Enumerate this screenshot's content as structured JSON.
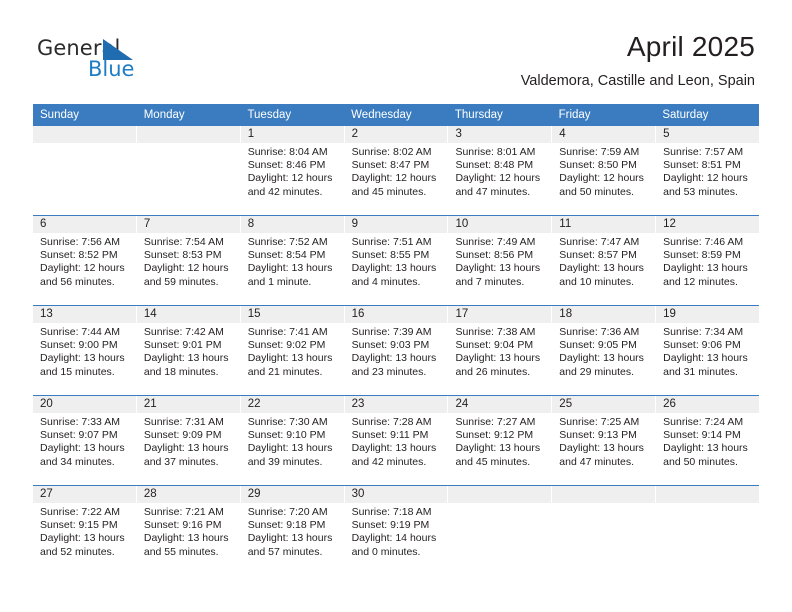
{
  "brand": {
    "line1": "General",
    "line2": "Blue",
    "mark": "triangle-logo-icon",
    "accent": "#1f7dc4"
  },
  "header": {
    "title": "April 2025",
    "subtitle": "Valdemora, Castille and Leon, Spain"
  },
  "colors": {
    "header_blue": "#3a7cbf",
    "daynum_band": "#efefef",
    "text": "#231f20"
  },
  "weekday_headers": [
    "Sunday",
    "Monday",
    "Tuesday",
    "Wednesday",
    "Thursday",
    "Friday",
    "Saturday"
  ],
  "labels": {
    "sunrise_prefix": "Sunrise:",
    "sunset_prefix": "Sunset:",
    "daylight_prefix": "Daylight:"
  },
  "weeks": [
    [
      {
        "day": "",
        "sunrise": "",
        "sunset": "",
        "daylight": "",
        "empty": true
      },
      {
        "day": "",
        "sunrise": "",
        "sunset": "",
        "daylight": "",
        "empty": true
      },
      {
        "day": "1",
        "sunrise": "Sunrise: 8:04 AM",
        "sunset": "Sunset: 8:46 PM",
        "daylight_l1": "Daylight: 12 hours",
        "daylight_l2": "and 42 minutes."
      },
      {
        "day": "2",
        "sunrise": "Sunrise: 8:02 AM",
        "sunset": "Sunset: 8:47 PM",
        "daylight_l1": "Daylight: 12 hours",
        "daylight_l2": "and 45 minutes."
      },
      {
        "day": "3",
        "sunrise": "Sunrise: 8:01 AM",
        "sunset": "Sunset: 8:48 PM",
        "daylight_l1": "Daylight: 12 hours",
        "daylight_l2": "and 47 minutes."
      },
      {
        "day": "4",
        "sunrise": "Sunrise: 7:59 AM",
        "sunset": "Sunset: 8:50 PM",
        "daylight_l1": "Daylight: 12 hours",
        "daylight_l2": "and 50 minutes."
      },
      {
        "day": "5",
        "sunrise": "Sunrise: 7:57 AM",
        "sunset": "Sunset: 8:51 PM",
        "daylight_l1": "Daylight: 12 hours",
        "daylight_l2": "and 53 minutes."
      }
    ],
    [
      {
        "day": "6",
        "sunrise": "Sunrise: 7:56 AM",
        "sunset": "Sunset: 8:52 PM",
        "daylight_l1": "Daylight: 12 hours",
        "daylight_l2": "and 56 minutes."
      },
      {
        "day": "7",
        "sunrise": "Sunrise: 7:54 AM",
        "sunset": "Sunset: 8:53 PM",
        "daylight_l1": "Daylight: 12 hours",
        "daylight_l2": "and 59 minutes."
      },
      {
        "day": "8",
        "sunrise": "Sunrise: 7:52 AM",
        "sunset": "Sunset: 8:54 PM",
        "daylight_l1": "Daylight: 13 hours",
        "daylight_l2": "and 1 minute."
      },
      {
        "day": "9",
        "sunrise": "Sunrise: 7:51 AM",
        "sunset": "Sunset: 8:55 PM",
        "daylight_l1": "Daylight: 13 hours",
        "daylight_l2": "and 4 minutes."
      },
      {
        "day": "10",
        "sunrise": "Sunrise: 7:49 AM",
        "sunset": "Sunset: 8:56 PM",
        "daylight_l1": "Daylight: 13 hours",
        "daylight_l2": "and 7 minutes."
      },
      {
        "day": "11",
        "sunrise": "Sunrise: 7:47 AM",
        "sunset": "Sunset: 8:57 PM",
        "daylight_l1": "Daylight: 13 hours",
        "daylight_l2": "and 10 minutes."
      },
      {
        "day": "12",
        "sunrise": "Sunrise: 7:46 AM",
        "sunset": "Sunset: 8:59 PM",
        "daylight_l1": "Daylight: 13 hours",
        "daylight_l2": "and 12 minutes."
      }
    ],
    [
      {
        "day": "13",
        "sunrise": "Sunrise: 7:44 AM",
        "sunset": "Sunset: 9:00 PM",
        "daylight_l1": "Daylight: 13 hours",
        "daylight_l2": "and 15 minutes."
      },
      {
        "day": "14",
        "sunrise": "Sunrise: 7:42 AM",
        "sunset": "Sunset: 9:01 PM",
        "daylight_l1": "Daylight: 13 hours",
        "daylight_l2": "and 18 minutes."
      },
      {
        "day": "15",
        "sunrise": "Sunrise: 7:41 AM",
        "sunset": "Sunset: 9:02 PM",
        "daylight_l1": "Daylight: 13 hours",
        "daylight_l2": "and 21 minutes."
      },
      {
        "day": "16",
        "sunrise": "Sunrise: 7:39 AM",
        "sunset": "Sunset: 9:03 PM",
        "daylight_l1": "Daylight: 13 hours",
        "daylight_l2": "and 23 minutes."
      },
      {
        "day": "17",
        "sunrise": "Sunrise: 7:38 AM",
        "sunset": "Sunset: 9:04 PM",
        "daylight_l1": "Daylight: 13 hours",
        "daylight_l2": "and 26 minutes."
      },
      {
        "day": "18",
        "sunrise": "Sunrise: 7:36 AM",
        "sunset": "Sunset: 9:05 PM",
        "daylight_l1": "Daylight: 13 hours",
        "daylight_l2": "and 29 minutes."
      },
      {
        "day": "19",
        "sunrise": "Sunrise: 7:34 AM",
        "sunset": "Sunset: 9:06 PM",
        "daylight_l1": "Daylight: 13 hours",
        "daylight_l2": "and 31 minutes."
      }
    ],
    [
      {
        "day": "20",
        "sunrise": "Sunrise: 7:33 AM",
        "sunset": "Sunset: 9:07 PM",
        "daylight_l1": "Daylight: 13 hours",
        "daylight_l2": "and 34 minutes."
      },
      {
        "day": "21",
        "sunrise": "Sunrise: 7:31 AM",
        "sunset": "Sunset: 9:09 PM",
        "daylight_l1": "Daylight: 13 hours",
        "daylight_l2": "and 37 minutes."
      },
      {
        "day": "22",
        "sunrise": "Sunrise: 7:30 AM",
        "sunset": "Sunset: 9:10 PM",
        "daylight_l1": "Daylight: 13 hours",
        "daylight_l2": "and 39 minutes."
      },
      {
        "day": "23",
        "sunrise": "Sunrise: 7:28 AM",
        "sunset": "Sunset: 9:11 PM",
        "daylight_l1": "Daylight: 13 hours",
        "daylight_l2": "and 42 minutes."
      },
      {
        "day": "24",
        "sunrise": "Sunrise: 7:27 AM",
        "sunset": "Sunset: 9:12 PM",
        "daylight_l1": "Daylight: 13 hours",
        "daylight_l2": "and 45 minutes."
      },
      {
        "day": "25",
        "sunrise": "Sunrise: 7:25 AM",
        "sunset": "Sunset: 9:13 PM",
        "daylight_l1": "Daylight: 13 hours",
        "daylight_l2": "and 47 minutes."
      },
      {
        "day": "26",
        "sunrise": "Sunrise: 7:24 AM",
        "sunset": "Sunset: 9:14 PM",
        "daylight_l1": "Daylight: 13 hours",
        "daylight_l2": "and 50 minutes."
      }
    ],
    [
      {
        "day": "27",
        "sunrise": "Sunrise: 7:22 AM",
        "sunset": "Sunset: 9:15 PM",
        "daylight_l1": "Daylight: 13 hours",
        "daylight_l2": "and 52 minutes."
      },
      {
        "day": "28",
        "sunrise": "Sunrise: 7:21 AM",
        "sunset": "Sunset: 9:16 PM",
        "daylight_l1": "Daylight: 13 hours",
        "daylight_l2": "and 55 minutes."
      },
      {
        "day": "29",
        "sunrise": "Sunrise: 7:20 AM",
        "sunset": "Sunset: 9:18 PM",
        "daylight_l1": "Daylight: 13 hours",
        "daylight_l2": "and 57 minutes."
      },
      {
        "day": "30",
        "sunrise": "Sunrise: 7:18 AM",
        "sunset": "Sunset: 9:19 PM",
        "daylight_l1": "Daylight: 14 hours",
        "daylight_l2": "and 0 minutes."
      },
      {
        "day": "",
        "sunrise": "",
        "sunset": "",
        "daylight": "",
        "empty": true
      },
      {
        "day": "",
        "sunrise": "",
        "sunset": "",
        "daylight": "",
        "empty": true
      },
      {
        "day": "",
        "sunrise": "",
        "sunset": "",
        "daylight": "",
        "empty": true
      }
    ]
  ]
}
